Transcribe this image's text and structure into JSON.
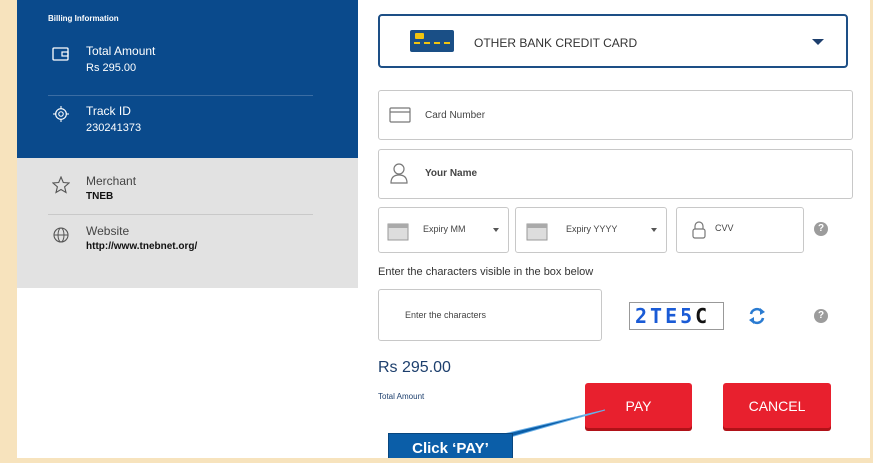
{
  "billing": {
    "heading": "Billing Information",
    "total_label": "Total Amount",
    "total_value": "Rs 295.00",
    "track_label": "Track ID",
    "track_value": "230241373"
  },
  "merchant": {
    "merchant_label": "Merchant",
    "merchant_value": "TNEB",
    "website_label": "Website",
    "website_value": "http://www.tnebnet.org/"
  },
  "payment": {
    "bank_option": "OTHER BANK CREDIT CARD",
    "card_number_placeholder": "Card Number",
    "name_placeholder": "Your Name",
    "expiry_mm_placeholder": "Expiry MM",
    "expiry_yyyy_placeholder": "Expiry YYYY",
    "cvv_placeholder": "CVV",
    "captcha_hint": "Enter the characters visible in the box below",
    "captcha_placeholder": "Enter the characters",
    "captcha_text_1": "2TE5",
    "captcha_text_2": "C",
    "help_glyph": "?",
    "amount": "Rs 295.00",
    "amount_label": "Total Amount",
    "pay_label": "PAY",
    "cancel_label": "CANCEL"
  },
  "annotation": {
    "callout_text": "Click ‘PAY’"
  },
  "colors": {
    "billing_bg": "#0a4a8c",
    "merchant_bg": "#e2e2e2",
    "button_red": "#e8202e",
    "callout_blue": "#0b5ea8",
    "page_bg": "#f7e3bd"
  },
  "icons": [
    "wallet-icon",
    "target-icon",
    "star-icon",
    "globe-icon",
    "credit-card-icon",
    "card-icon",
    "user-icon",
    "calendar-icon",
    "lock-icon",
    "help-icon",
    "refresh-icon",
    "chevron-down-icon"
  ]
}
